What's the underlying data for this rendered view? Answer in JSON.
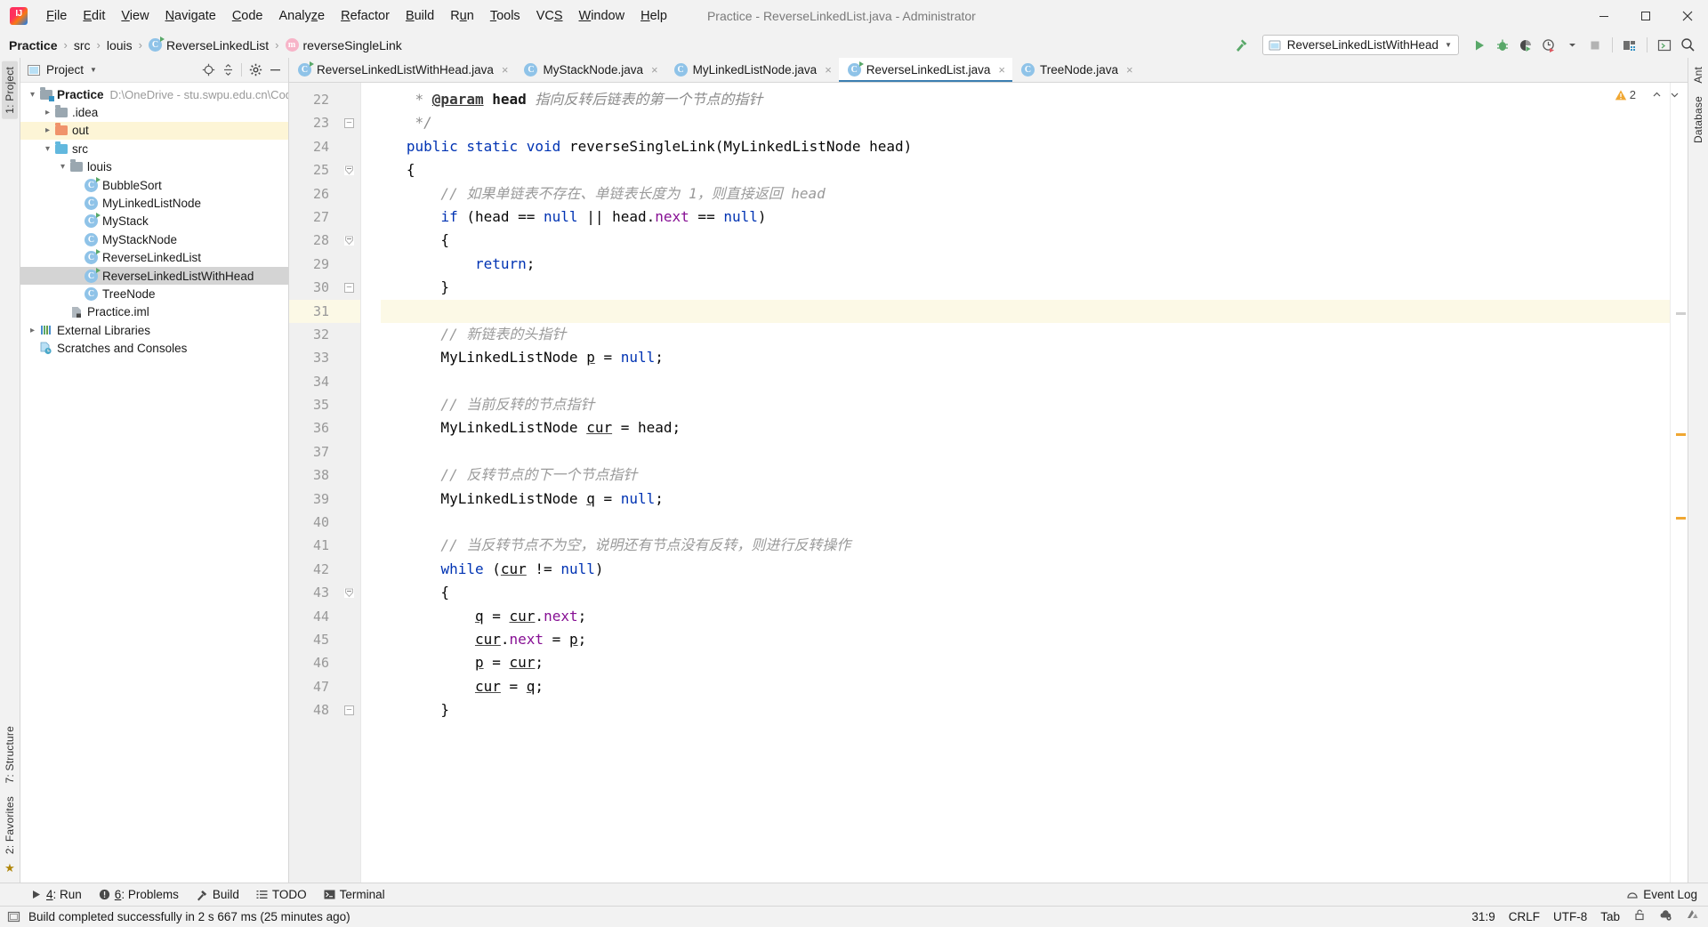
{
  "window": {
    "title": "Practice - ReverseLinkedList.java - Administrator",
    "logo_text": "IJ"
  },
  "menubar": {
    "items": [
      {
        "label": "File",
        "mnemonic": "F"
      },
      {
        "label": "Edit",
        "mnemonic": "E"
      },
      {
        "label": "View",
        "mnemonic": "V"
      },
      {
        "label": "Navigate",
        "mnemonic": "N"
      },
      {
        "label": "Code",
        "mnemonic": "C"
      },
      {
        "label": "Analyze",
        "mnemonic": "z"
      },
      {
        "label": "Refactor",
        "mnemonic": "R"
      },
      {
        "label": "Build",
        "mnemonic": "B"
      },
      {
        "label": "Run",
        "mnemonic": "u"
      },
      {
        "label": "Tools",
        "mnemonic": "T"
      },
      {
        "label": "VCS",
        "mnemonic": "S"
      },
      {
        "label": "Window",
        "mnemonic": "W"
      },
      {
        "label": "Help",
        "mnemonic": "H"
      }
    ]
  },
  "window_controls": {
    "minimize": "minimize-icon",
    "maximize": "maximize-icon",
    "close": "close-icon"
  },
  "breadcrumb": {
    "items": [
      {
        "label": "Practice",
        "icon": "",
        "bold": true
      },
      {
        "label": "src",
        "icon": "",
        "bold": false
      },
      {
        "label": "louis",
        "icon": "",
        "bold": false
      },
      {
        "label": "ReverseLinkedList",
        "icon": "class-icon",
        "bold": false
      },
      {
        "label": "reverseSingleLink",
        "icon": "method-icon",
        "bold": false
      }
    ],
    "separator": "›"
  },
  "toolbar": {
    "build_icon": "hammer-icon",
    "run_config": {
      "label": "ReverseLinkedListWithHead",
      "icon": "application-icon",
      "dropdown": "▼"
    },
    "actions": [
      {
        "name": "run-button",
        "icon": "run-icon"
      },
      {
        "name": "debug-button",
        "icon": "debug-icon"
      },
      {
        "name": "run-with-coverage-button",
        "icon": "coverage-icon"
      },
      {
        "name": "profiler-button",
        "icon": "profiler-icon"
      },
      {
        "name": "profiler-dropdown",
        "icon": "chevron-down-icon"
      },
      {
        "name": "stop-button",
        "icon": "stop-icon"
      },
      {
        "name": "project-structure-button",
        "icon": "project-structure-icon"
      },
      {
        "name": "updates-button",
        "icon": "terminal-window-icon"
      },
      {
        "name": "search-everywhere-button",
        "icon": "search-icon"
      }
    ]
  },
  "left_strip": {
    "top": [
      "1: Project"
    ],
    "bottom": [
      "2: Favorites",
      "7: Structure"
    ]
  },
  "right_strip": {
    "items": [
      "Ant",
      "Database"
    ]
  },
  "project_panel": {
    "title": "Project",
    "title_dropdown": "▼",
    "header_icons": [
      {
        "name": "select-opened-file-icon"
      },
      {
        "name": "collapse-all-icon"
      },
      {
        "name": "gear-icon"
      },
      {
        "name": "hide-icon"
      }
    ],
    "tree": [
      {
        "depth": 0,
        "arrow": "expanded",
        "icon": "module-icon",
        "label": "Practice",
        "bold": true,
        "path": "D:\\OneDrive - stu.swpu.edu.cn\\Code",
        "state": "normal"
      },
      {
        "depth": 1,
        "arrow": "collapsed",
        "icon": "folder-gray",
        "label": ".idea",
        "bold": false,
        "path": "",
        "state": "normal"
      },
      {
        "depth": 1,
        "arrow": "collapsed",
        "icon": "folder-orange",
        "label": "out",
        "bold": false,
        "path": "",
        "state": "highlighted"
      },
      {
        "depth": 1,
        "arrow": "expanded",
        "icon": "folder-blue",
        "label": "src",
        "bold": false,
        "path": "",
        "state": "normal"
      },
      {
        "depth": 2,
        "arrow": "expanded",
        "icon": "package-icon",
        "label": "louis",
        "bold": false,
        "path": "",
        "state": "normal"
      },
      {
        "depth": 3,
        "arrow": "none",
        "icon": "class-runnable-icon",
        "label": "BubbleSort",
        "bold": false,
        "path": "",
        "state": "normal"
      },
      {
        "depth": 3,
        "arrow": "none",
        "icon": "class-icon",
        "label": "MyLinkedListNode",
        "bold": false,
        "path": "",
        "state": "normal"
      },
      {
        "depth": 3,
        "arrow": "none",
        "icon": "class-runnable-icon",
        "label": "MyStack",
        "bold": false,
        "path": "",
        "state": "normal"
      },
      {
        "depth": 3,
        "arrow": "none",
        "icon": "class-icon",
        "label": "MyStackNode",
        "bold": false,
        "path": "",
        "state": "normal"
      },
      {
        "depth": 3,
        "arrow": "none",
        "icon": "class-runnable-icon",
        "label": "ReverseLinkedList",
        "bold": false,
        "path": "",
        "state": "normal"
      },
      {
        "depth": 3,
        "arrow": "none",
        "icon": "class-runnable-icon",
        "label": "ReverseLinkedListWithHead",
        "bold": false,
        "path": "",
        "state": "selected"
      },
      {
        "depth": 3,
        "arrow": "none",
        "icon": "class-icon",
        "label": "TreeNode",
        "bold": false,
        "path": "",
        "state": "normal"
      },
      {
        "depth": 2,
        "arrow": "none",
        "icon": "iml-icon",
        "label": "Practice.iml",
        "bold": false,
        "path": "",
        "state": "normal"
      },
      {
        "depth": 0,
        "arrow": "collapsed",
        "icon": "libraries-icon",
        "label": "External Libraries",
        "bold": false,
        "path": "",
        "state": "normal"
      },
      {
        "depth": 0,
        "arrow": "none",
        "icon": "scratches-icon",
        "label": "Scratches and Consoles",
        "bold": false,
        "path": "",
        "state": "normal"
      }
    ]
  },
  "editor_tabs": [
    {
      "label": "ReverseLinkedListWithHead.java",
      "icon": "class-runnable-icon",
      "active": false,
      "close": "×"
    },
    {
      "label": "MyStackNode.java",
      "icon": "class-icon",
      "active": false,
      "close": "×"
    },
    {
      "label": "MyLinkedListNode.java",
      "icon": "class-icon",
      "active": false,
      "close": "×"
    },
    {
      "label": "ReverseLinkedList.java",
      "icon": "class-runnable-icon",
      "active": true,
      "close": "×"
    },
    {
      "label": "TreeNode.java",
      "icon": "class-icon",
      "active": false,
      "close": "×"
    }
  ],
  "editor": {
    "warning_count": "2",
    "warning_icon": "warning-triangle-icon",
    "inspection_up_icon": "chevron-up-icon",
    "inspection_down_icon": "chevron-down-icon",
    "first_line": 22,
    "lines": [
      {
        "n": 22,
        "fold": "",
        "highlight": false,
        "tokens": [
          {
            "t": "    ",
            "c": "pln"
          },
          {
            "t": "* ",
            "c": "doc"
          },
          {
            "t": "@param",
            "c": "tag"
          },
          {
            "t": " ",
            "c": "doc"
          },
          {
            "t": "head",
            "c": "prm"
          },
          {
            "t": " 指向反转后链表的第一个节点的指针",
            "c": "doc"
          }
        ]
      },
      {
        "n": 23,
        "fold": "minus",
        "highlight": false,
        "tokens": [
          {
            "t": "    */",
            "c": "doc"
          }
        ]
      },
      {
        "n": 24,
        "fold": "",
        "highlight": false,
        "tokens": [
          {
            "t": "   ",
            "c": "pln"
          },
          {
            "t": "public static void ",
            "c": "kw"
          },
          {
            "t": "reverseSingleLink",
            "c": "pln"
          },
          {
            "t": "(MyLinkedListNode head)",
            "c": "pln"
          }
        ]
      },
      {
        "n": 25,
        "fold": "tri-down",
        "highlight": false,
        "tokens": [
          {
            "t": "   {",
            "c": "pln"
          }
        ]
      },
      {
        "n": 26,
        "fold": "",
        "highlight": false,
        "tokens": [
          {
            "t": "       // 如果单链表不存在、单链表长度为 1，则直接返回 head",
            "c": "cmt"
          }
        ]
      },
      {
        "n": 27,
        "fold": "",
        "highlight": false,
        "tokens": [
          {
            "t": "       ",
            "c": "pln"
          },
          {
            "t": "if",
            "c": "kw"
          },
          {
            "t": " (head == ",
            "c": "pln"
          },
          {
            "t": "null",
            "c": "kw"
          },
          {
            "t": " || head.",
            "c": "pln"
          },
          {
            "t": "next",
            "c": "fld"
          },
          {
            "t": " == ",
            "c": "pln"
          },
          {
            "t": "null",
            "c": "kw"
          },
          {
            "t": ")",
            "c": "pln"
          }
        ]
      },
      {
        "n": 28,
        "fold": "tri-down",
        "highlight": false,
        "tokens": [
          {
            "t": "       {",
            "c": "pln"
          }
        ]
      },
      {
        "n": 29,
        "fold": "",
        "highlight": false,
        "tokens": [
          {
            "t": "           ",
            "c": "pln"
          },
          {
            "t": "return",
            "c": "kw"
          },
          {
            "t": ";",
            "c": "pln"
          }
        ]
      },
      {
        "n": 30,
        "fold": "minus",
        "highlight": false,
        "tokens": [
          {
            "t": "       }",
            "c": "pln"
          }
        ]
      },
      {
        "n": 31,
        "fold": "",
        "highlight": true,
        "tokens": [
          {
            "t": "",
            "c": "pln"
          }
        ]
      },
      {
        "n": 32,
        "fold": "",
        "highlight": false,
        "tokens": [
          {
            "t": "       // 新链表的头指针",
            "c": "cmt"
          }
        ]
      },
      {
        "n": 33,
        "fold": "",
        "highlight": false,
        "tokens": [
          {
            "t": "       MyLinkedListNode ",
            "c": "pln"
          },
          {
            "t": "p",
            "c": "und"
          },
          {
            "t": " = ",
            "c": "pln"
          },
          {
            "t": "null",
            "c": "kw"
          },
          {
            "t": ";",
            "c": "pln"
          }
        ]
      },
      {
        "n": 34,
        "fold": "",
        "highlight": false,
        "tokens": [
          {
            "t": "",
            "c": "pln"
          }
        ]
      },
      {
        "n": 35,
        "fold": "",
        "highlight": false,
        "tokens": [
          {
            "t": "       // 当前反转的节点指针",
            "c": "cmt"
          }
        ]
      },
      {
        "n": 36,
        "fold": "",
        "highlight": false,
        "tokens": [
          {
            "t": "       MyLinkedListNode ",
            "c": "pln"
          },
          {
            "t": "cur",
            "c": "und"
          },
          {
            "t": " = head;",
            "c": "pln"
          }
        ]
      },
      {
        "n": 37,
        "fold": "",
        "highlight": false,
        "tokens": [
          {
            "t": "",
            "c": "pln"
          }
        ]
      },
      {
        "n": 38,
        "fold": "",
        "highlight": false,
        "tokens": [
          {
            "t": "       // 反转节点的下一个节点指针",
            "c": "cmt"
          }
        ]
      },
      {
        "n": 39,
        "fold": "",
        "highlight": false,
        "tokens": [
          {
            "t": "       MyLinkedListNode ",
            "c": "pln"
          },
          {
            "t": "q",
            "c": "und"
          },
          {
            "t": " = ",
            "c": "pln"
          },
          {
            "t": "null",
            "c": "kw"
          },
          {
            "t": ";",
            "c": "pln"
          }
        ]
      },
      {
        "n": 40,
        "fold": "",
        "highlight": false,
        "tokens": [
          {
            "t": "",
            "c": "pln"
          }
        ]
      },
      {
        "n": 41,
        "fold": "",
        "highlight": false,
        "tokens": [
          {
            "t": "       // 当反转节点不为空，说明还有节点没有反转，则进行反转操作",
            "c": "cmt"
          }
        ]
      },
      {
        "n": 42,
        "fold": "",
        "highlight": false,
        "tokens": [
          {
            "t": "       ",
            "c": "pln"
          },
          {
            "t": "while",
            "c": "kw"
          },
          {
            "t": " (",
            "c": "pln"
          },
          {
            "t": "cur",
            "c": "und"
          },
          {
            "t": " != ",
            "c": "pln"
          },
          {
            "t": "null",
            "c": "kw"
          },
          {
            "t": ")",
            "c": "pln"
          }
        ]
      },
      {
        "n": 43,
        "fold": "tri-down",
        "highlight": false,
        "tokens": [
          {
            "t": "       {",
            "c": "pln"
          }
        ]
      },
      {
        "n": 44,
        "fold": "",
        "highlight": false,
        "tokens": [
          {
            "t": "           ",
            "c": "pln"
          },
          {
            "t": "q",
            "c": "und"
          },
          {
            "t": " = ",
            "c": "pln"
          },
          {
            "t": "cur",
            "c": "und"
          },
          {
            "t": ".",
            "c": "pln"
          },
          {
            "t": "next",
            "c": "fld"
          },
          {
            "t": ";",
            "c": "pln"
          }
        ]
      },
      {
        "n": 45,
        "fold": "",
        "highlight": false,
        "tokens": [
          {
            "t": "           ",
            "c": "pln"
          },
          {
            "t": "cur",
            "c": "und"
          },
          {
            "t": ".",
            "c": "pln"
          },
          {
            "t": "next",
            "c": "fld"
          },
          {
            "t": " = ",
            "c": "pln"
          },
          {
            "t": "p",
            "c": "und"
          },
          {
            "t": ";",
            "c": "pln"
          }
        ]
      },
      {
        "n": 46,
        "fold": "",
        "highlight": false,
        "tokens": [
          {
            "t": "           ",
            "c": "pln"
          },
          {
            "t": "p",
            "c": "und"
          },
          {
            "t": " = ",
            "c": "pln"
          },
          {
            "t": "cur",
            "c": "und"
          },
          {
            "t": ";",
            "c": "pln"
          }
        ]
      },
      {
        "n": 47,
        "fold": "",
        "highlight": false,
        "tokens": [
          {
            "t": "           ",
            "c": "pln"
          },
          {
            "t": "cur",
            "c": "und"
          },
          {
            "t": " = ",
            "c": "pln"
          },
          {
            "t": "q",
            "c": "und"
          },
          {
            "t": ";",
            "c": "pln"
          }
        ]
      },
      {
        "n": 48,
        "fold": "minus",
        "highlight": false,
        "tokens": [
          {
            "t": "       }",
            "c": "pln"
          }
        ]
      }
    ]
  },
  "tool_window_bar": {
    "items": [
      {
        "label": "4: Run",
        "mnemonic": "4",
        "icon": "run-icon"
      },
      {
        "label": "6: Problems",
        "mnemonic": "6",
        "icon": "problems-icon"
      },
      {
        "label": "Build",
        "mnemonic": "",
        "icon": "hammer-icon"
      },
      {
        "label": "TODO",
        "mnemonic": "",
        "icon": "todo-icon"
      },
      {
        "label": "Terminal",
        "mnemonic": "",
        "icon": "terminal-icon"
      }
    ],
    "event_log": {
      "label": "Event Log",
      "icon": "event-log-icon"
    }
  },
  "statusbar": {
    "message": "Build completed successfully in 2 s 667 ms (25 minutes ago)",
    "message_icon": "memory-indicator-icon",
    "caret_position": "31:9",
    "line_separator": "CRLF",
    "encoding": "UTF-8",
    "indent": "Tab",
    "lock_icon": "unlock-icon",
    "cloud_icon": "cloud-gear-icon",
    "branch_icon": "vcs-icon"
  }
}
